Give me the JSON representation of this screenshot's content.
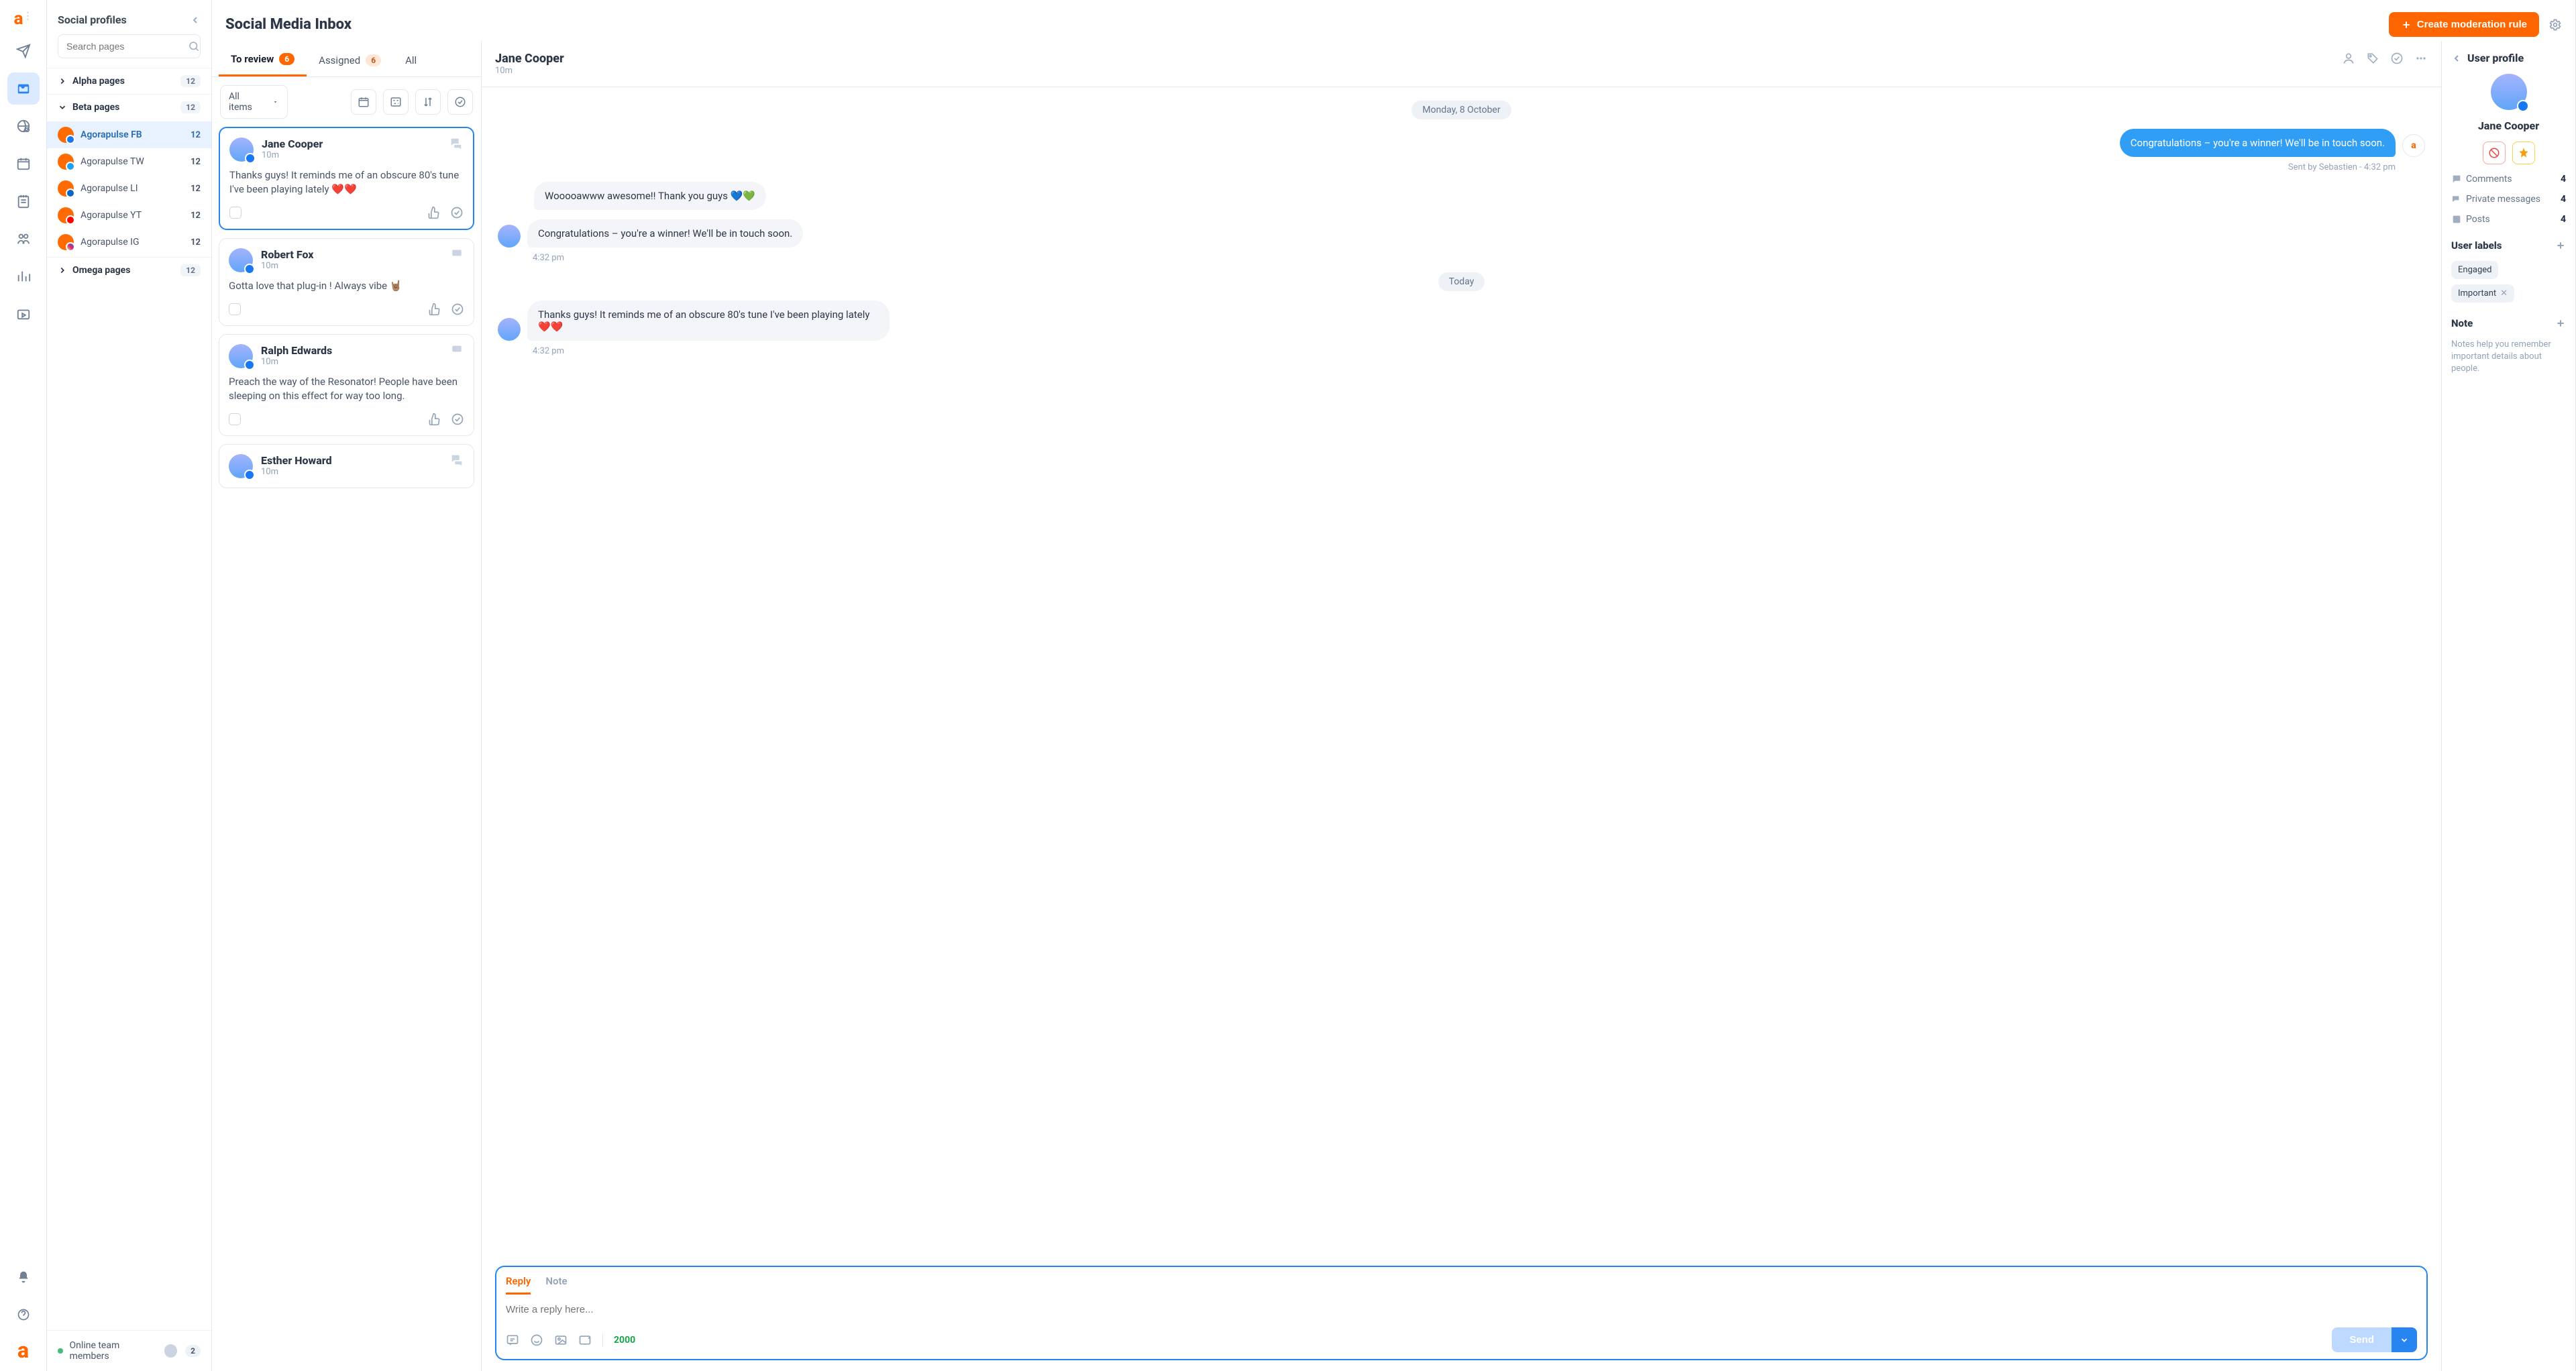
{
  "header": {
    "title": "Social Media Inbox",
    "create_rule": "Create moderation rule"
  },
  "sidebar": {
    "title": "Social profiles",
    "search_placeholder": "Search pages",
    "groups": [
      {
        "name": "Alpha pages",
        "count": "12",
        "expanded": false
      },
      {
        "name": "Beta pages",
        "count": "12",
        "expanded": true
      },
      {
        "name": "Omega pages",
        "count": "12",
        "expanded": false
      }
    ],
    "channels": [
      {
        "name": "Agorapulse FB",
        "count": "12",
        "net": "fb",
        "active": true
      },
      {
        "name": "Agorapulse TW",
        "count": "12",
        "net": "tw"
      },
      {
        "name": "Agorapulse LI",
        "count": "12",
        "net": "li"
      },
      {
        "name": "Agorapulse YT",
        "count": "12",
        "net": "yt"
      },
      {
        "name": "Agorapulse IG",
        "count": "12",
        "net": "ig"
      }
    ],
    "footer": {
      "label": "Online team members",
      "count": "2"
    }
  },
  "tabs": {
    "to_review": {
      "label": "To review",
      "count": "6"
    },
    "assigned": {
      "label": "Assigned",
      "count": "6"
    },
    "all": {
      "label": "All"
    }
  },
  "filter": {
    "label": "All items"
  },
  "cards": [
    {
      "name": "Jane Cooper",
      "time": "10m",
      "body": "Thanks guys! It reminds me of an obscure 80's tune I've been playing lately ❤️❤️"
    },
    {
      "name": "Robert Fox",
      "time": "10m",
      "body": "Gotta love that plug-in ! Always vibe 🤘🏽"
    },
    {
      "name": "Ralph Edwards",
      "time": "10m",
      "body": "Preach the way of the Resonator! People have been sleeping on this effect for way too long."
    },
    {
      "name": "Esther Howard",
      "time": "10m",
      "body": ""
    }
  ],
  "conversation": {
    "name": "Jane Cooper",
    "time": "10m",
    "date1": "Monday, 8 October",
    "date2": "Today",
    "messages": {
      "sent1": "Congratulations – you're a winner! We'll be in touch soon.",
      "sent1_meta": "Sent by Sebastien - 4:32 pm",
      "recv1": "Wooooawww awesome!! Thank you guys 💙💚",
      "recv2": "Congratulations – you're a winner! We'll be in touch soon.",
      "recv2_meta": "4:32 pm",
      "recv3": "Thanks guys! It reminds me of an obscure 80's tune I've been playing lately ❤️❤️",
      "recv3_meta": "4:32 pm"
    }
  },
  "composer": {
    "tabs": {
      "reply": "Reply",
      "note": "Note"
    },
    "placeholder": "Write a reply here...",
    "char_count": "2000",
    "send": "Send"
  },
  "profile": {
    "title": "User profile",
    "name": "Jane Cooper",
    "stats": {
      "comments": {
        "label": "Comments",
        "n": "4"
      },
      "pm": {
        "label": "Private messages",
        "n": "4"
      },
      "posts": {
        "label": "Posts",
        "n": "4"
      }
    },
    "labels_title": "User labels",
    "labels": [
      {
        "text": "Engaged",
        "removable": false
      },
      {
        "text": "Important",
        "removable": true
      }
    ],
    "note_title": "Note",
    "note_help": "Notes help you remember important details about people."
  }
}
